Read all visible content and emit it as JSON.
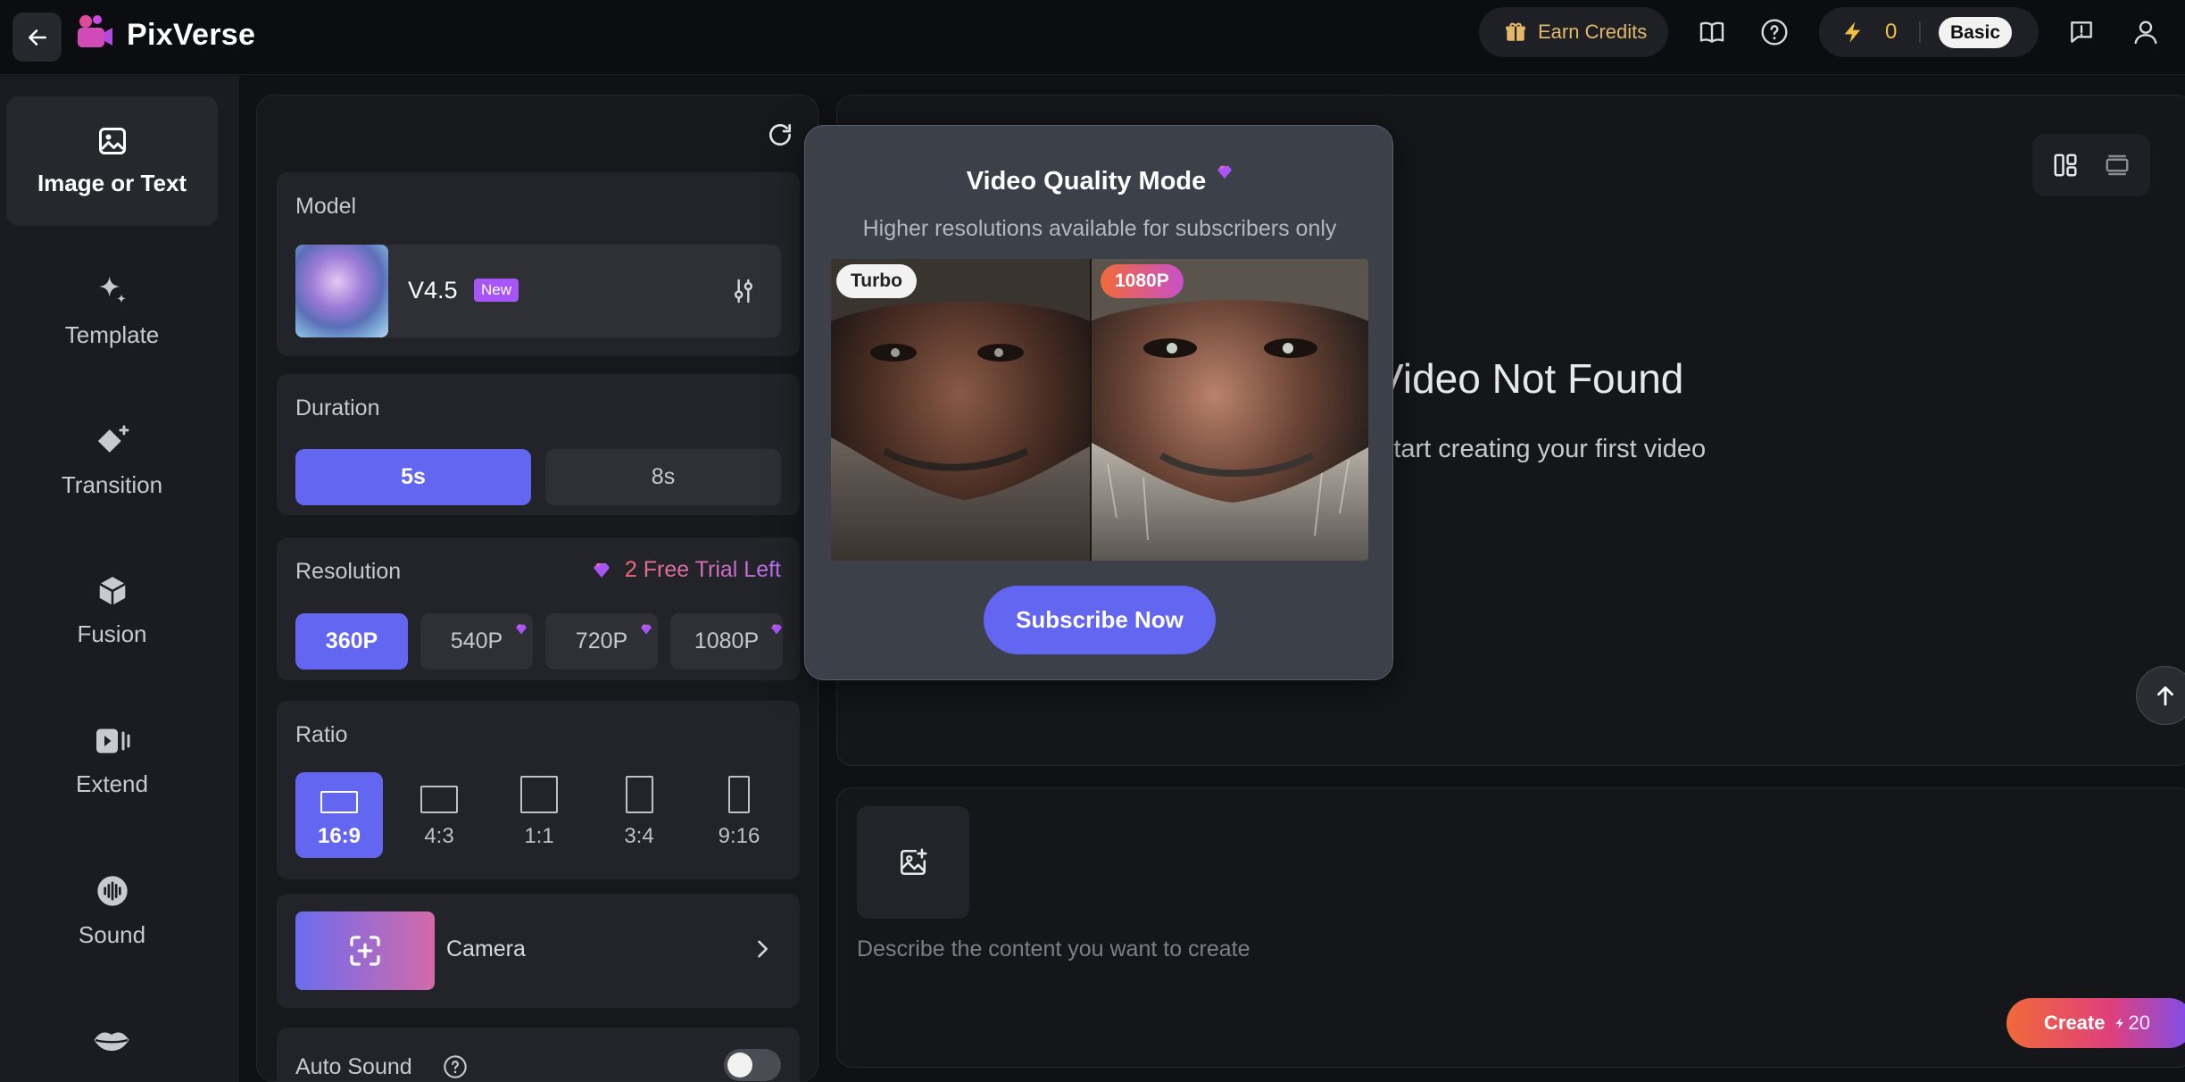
{
  "header": {
    "brand": "PixVerse",
    "earn_credits": "Earn Credits",
    "credit_count": "0",
    "plan": "Basic"
  },
  "nav": {
    "items": [
      {
        "label": "Image or Text",
        "icon": "image-icon"
      },
      {
        "label": "Template",
        "icon": "sparkle-icon"
      },
      {
        "label": "Transition",
        "icon": "transition-icon"
      },
      {
        "label": "Fusion",
        "icon": "cube-icon"
      },
      {
        "label": "Extend",
        "icon": "extend-icon"
      },
      {
        "label": "Sound",
        "icon": "sound-icon"
      },
      {
        "label": "",
        "icon": "lips-icon"
      }
    ]
  },
  "settings": {
    "model": {
      "title": "Model",
      "name": "V4.5",
      "badge": "New"
    },
    "duration": {
      "title": "Duration",
      "options": [
        "5s",
        "8s"
      ],
      "selected": "5s"
    },
    "resolution": {
      "title": "Resolution",
      "trial": "2 Free Trial Left",
      "options": [
        "360P",
        "540P",
        "720P",
        "1080P"
      ],
      "selected": "360P"
    },
    "ratio": {
      "title": "Ratio",
      "options": [
        "16:9",
        "4:3",
        "1:1",
        "3:4",
        "9:16"
      ],
      "selected": "16:9"
    },
    "camera": {
      "label": "Camera"
    },
    "auto_sound": {
      "label": "Auto Sound",
      "enabled": false
    }
  },
  "preview": {
    "empty_title": "Video Not Found",
    "empty_sub": "Start creating your first video"
  },
  "popup": {
    "title": "Video Quality Mode",
    "subtitle": "Higher resolutions available for subscribers only",
    "left_tag": "Turbo",
    "right_tag": "1080P",
    "cta": "Subscribe Now"
  },
  "prompt": {
    "placeholder": "Describe the content you want to create",
    "create_label": "Create",
    "create_cost": "20"
  },
  "colors": {
    "accent": "#6366f1",
    "credit": "#f0c040",
    "earn": "#e4b86a",
    "trial": "#f06a7a"
  }
}
